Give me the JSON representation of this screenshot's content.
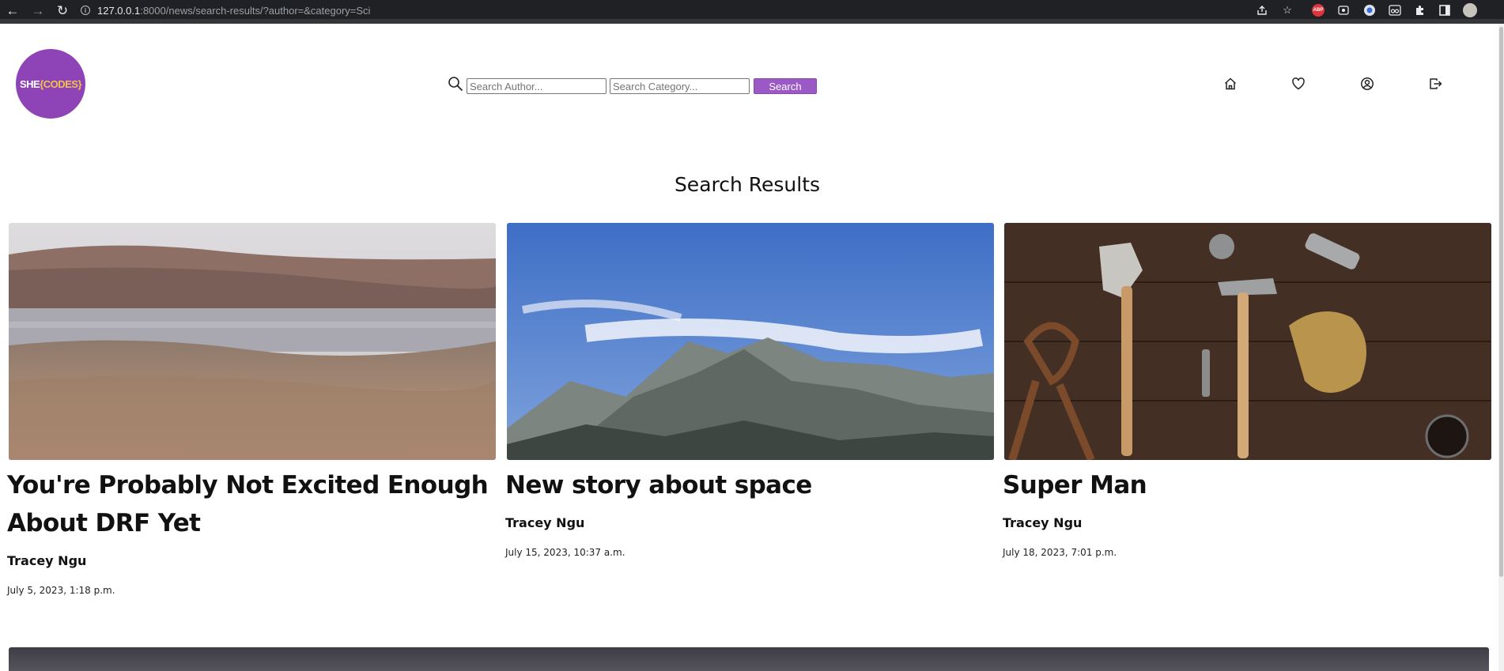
{
  "browser": {
    "url_host": "127.0.0.1",
    "url_rest": ":8000/news/search-results/?author=&category=Sci",
    "extensions": [
      "share-icon",
      "star-icon",
      "adblock-icon",
      "extension-icon",
      "extension-icon",
      "extension-icon",
      "puzzle-icon",
      "sidepanel-icon",
      "profile-avatar"
    ],
    "abp_label": "ABP"
  },
  "header": {
    "logo": {
      "part1": "SHE",
      "part2": "{CODES}"
    },
    "search": {
      "author_placeholder": "Search Author...",
      "category_placeholder": "Search Category...",
      "button_label": "Search"
    },
    "nav_icons": [
      "home-icon",
      "heart-icon",
      "user-icon",
      "logout-icon"
    ]
  },
  "main": {
    "title": "Search Results",
    "stories": [
      {
        "title": "You're Probably Not Excited Enough About DRF Yet",
        "author": "Tracey Ngu",
        "date": "July 5, 2023, 1:18 p.m.",
        "image": "lake-landscape"
      },
      {
        "title": "New story about space",
        "author": "Tracey Ngu",
        "date": "July 15, 2023, 10:37 a.m.",
        "image": "mountain-sky"
      },
      {
        "title": "Super Man",
        "author": "Tracey Ngu",
        "date": "July 18, 2023, 7:01 p.m.",
        "image": "tools-on-wood"
      }
    ]
  },
  "colors": {
    "brand_purple": "#8e44b6",
    "button_purple": "#9b59c6",
    "browser_bg": "#202124"
  }
}
